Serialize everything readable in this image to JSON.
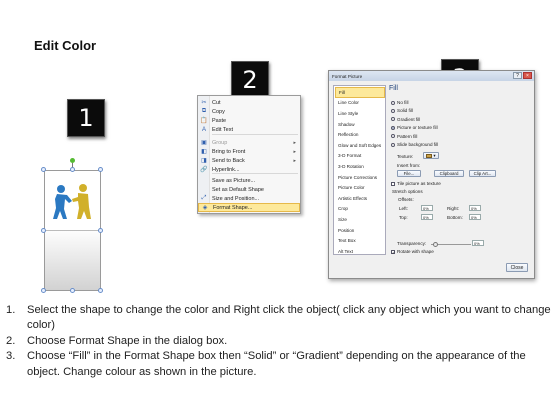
{
  "title": "Edit Color",
  "steps": [
    "1",
    "2",
    "3"
  ],
  "context_menu": {
    "items": [
      {
        "label": "Cut",
        "icon": "scissors-icon",
        "glyph": "✂",
        "disabled": false,
        "arrow": ""
      },
      {
        "label": "Copy",
        "icon": "copy-icon",
        "glyph": "⧉",
        "disabled": false,
        "arrow": ""
      },
      {
        "label": "Paste",
        "icon": "paste-icon",
        "glyph": "📋",
        "disabled": false,
        "arrow": ""
      },
      {
        "label": "Edit Text",
        "icon": "edit-text-icon",
        "glyph": "A",
        "disabled": false,
        "arrow": ""
      },
      {
        "label": "Group",
        "icon": "group-icon",
        "glyph": "▣",
        "disabled": true,
        "arrow": "▸"
      },
      {
        "label": "Bring to Front",
        "icon": "bring-to-front-icon",
        "glyph": "◧",
        "disabled": false,
        "arrow": "▸"
      },
      {
        "label": "Send to Back",
        "icon": "send-to-back-icon",
        "glyph": "◨",
        "disabled": false,
        "arrow": "▸"
      },
      {
        "label": "Hyperlink...",
        "icon": "hyperlink-icon",
        "glyph": "🔗",
        "disabled": false,
        "arrow": ""
      },
      {
        "label": "Save as Picture...",
        "icon": "save-picture-icon",
        "glyph": "",
        "disabled": false,
        "arrow": ""
      },
      {
        "label": "Set as Default Shape",
        "icon": "default-shape-icon",
        "glyph": "",
        "disabled": false,
        "arrow": ""
      },
      {
        "label": "Size and Position...",
        "icon": "size-position-icon",
        "glyph": "⤢",
        "disabled": false,
        "arrow": ""
      },
      {
        "label": "Format Shape...",
        "icon": "format-shape-icon",
        "glyph": "◈",
        "disabled": false,
        "arrow": "",
        "highlighted": true
      }
    ]
  },
  "dialog": {
    "title": "Format Picture",
    "nav_items": [
      "Fill",
      "Line Color",
      "Line Style",
      "Shadow",
      "Reflection",
      "Glow and Soft Edges",
      "3-D Format",
      "3-D Rotation",
      "Picture Corrections",
      "Picture Color",
      "Artistic Effects",
      "Crop",
      "Size",
      "Position",
      "Text Box",
      "Alt Text"
    ],
    "selected_nav": "Fill",
    "fill_heading": "Fill",
    "fill_options": [
      "No fill",
      "Solid fill",
      "Gradient fill",
      "Picture or texture fill",
      "Pattern fill",
      "Slide background fill"
    ],
    "selected_fill": "Picture or texture fill",
    "texture_label": "Texture:",
    "insert_from_label": "Insert from:",
    "file_button": "File...",
    "clipboard_button": "Clipboard",
    "clip_art_button": "Clip Art...",
    "tile_label": "Tile picture as texture",
    "stretch_label": "Stretch options",
    "offsets_label": "Offsets:",
    "left_label": "Left:",
    "right_label": "Right:",
    "top_label": "Top:",
    "bottom_label": "Bottom:",
    "offset_value": "0%",
    "transparency_label": "Transparency:",
    "transparency_value": "0%",
    "rotate_label": "Rotate with shape",
    "close_button": "Close"
  },
  "instructions": [
    {
      "num": "1.",
      "text": "Select the shape to change the color and Right click the object( click any object which you want to change color)"
    },
    {
      "num": "2.",
      "text": "Choose Format Shape in the dialog box."
    },
    {
      "num": "3.",
      "text": "Choose “Fill” in the Format Shape box then “Solid” or “Gradient” depending on the appearance of the object. Change colour as shown in the picture."
    }
  ]
}
